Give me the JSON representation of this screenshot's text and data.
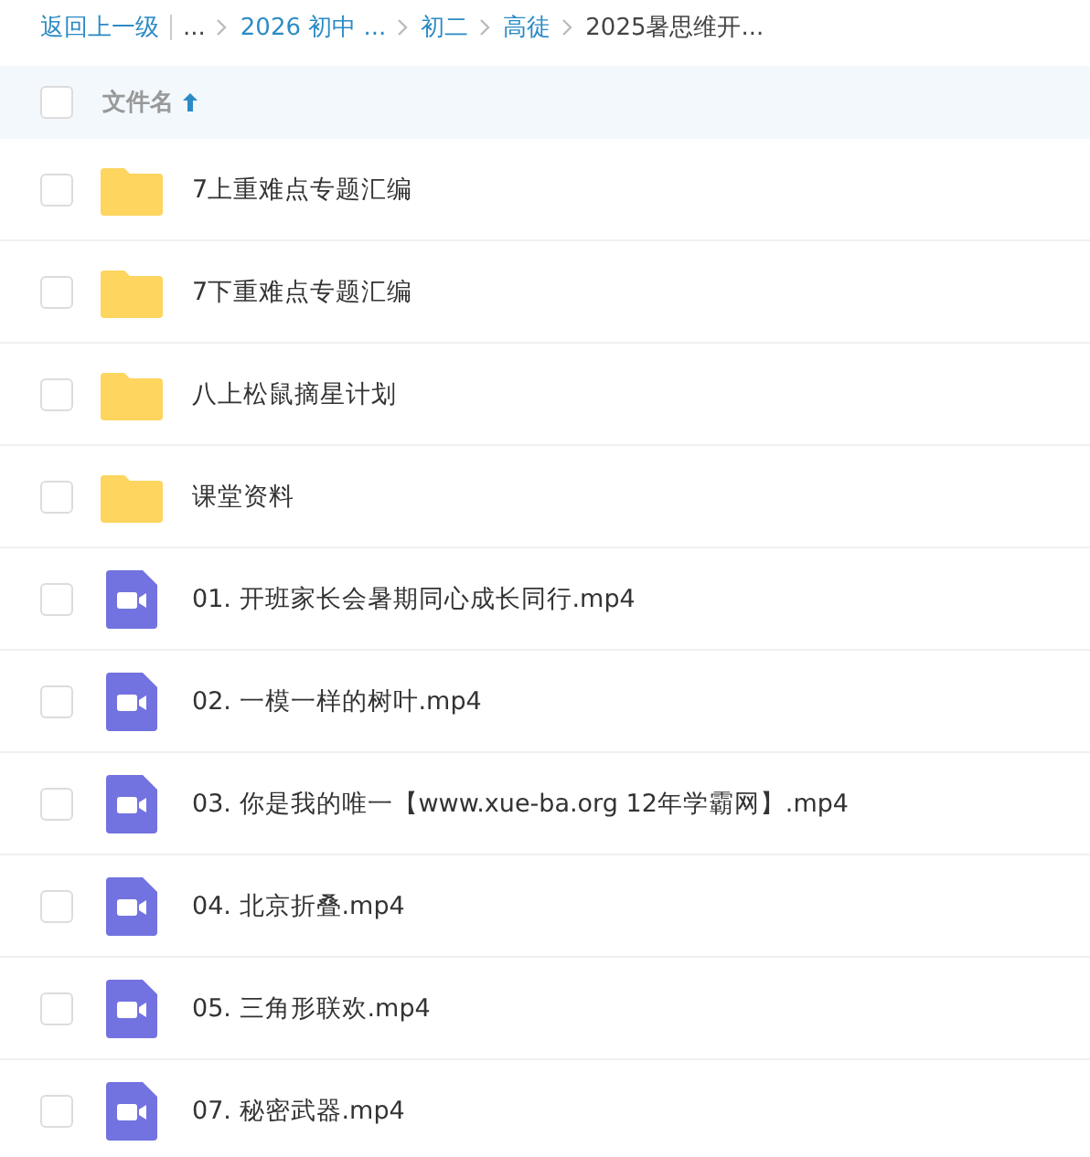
{
  "breadcrumb": {
    "back_link": "返回上一级",
    "crumbs": [
      {
        "label": "...",
        "kind": "ellipsis"
      },
      {
        "label": "2026 初中 ...",
        "kind": "link"
      },
      {
        "label": "初二",
        "kind": "link"
      },
      {
        "label": "高徒",
        "kind": "link"
      },
      {
        "label": "2025暑思维开...",
        "kind": "current"
      }
    ]
  },
  "header": {
    "checked": false,
    "column": "文件名",
    "sort_ascending": true
  },
  "files": [
    {
      "name": "7上重难点专题汇编",
      "kind": "folder",
      "checked": false
    },
    {
      "name": "7下重难点专题汇编",
      "kind": "folder",
      "checked": false
    },
    {
      "name": "八上松鼠摘星计划",
      "kind": "folder",
      "checked": false
    },
    {
      "name": "课堂资料",
      "kind": "folder",
      "checked": false
    },
    {
      "name": "01. 开班家长会暑期同心成长同行.mp4",
      "kind": "video",
      "checked": false
    },
    {
      "name": "02. 一模一样的树叶.mp4",
      "kind": "video",
      "checked": false
    },
    {
      "name": "03. 你是我的唯一【www.xue-ba.org 12年学霸网】.mp4",
      "kind": "video",
      "checked": false
    },
    {
      "name": "04. 北京折叠.mp4",
      "kind": "video",
      "checked": false
    },
    {
      "name": "05. 三角形联欢.mp4",
      "kind": "video",
      "checked": false
    },
    {
      "name": "07. 秘密武器.mp4",
      "kind": "video",
      "checked": false
    }
  ]
}
